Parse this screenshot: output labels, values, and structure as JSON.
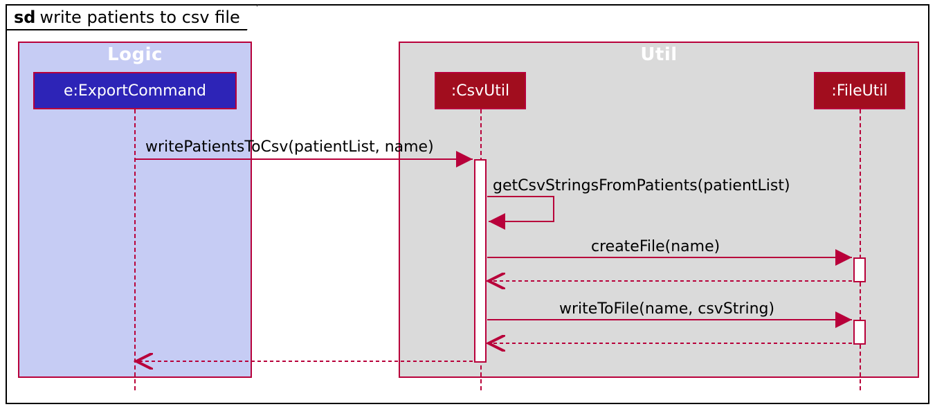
{
  "frame": {
    "tag_prefix": "sd",
    "title": "write patients to csv file"
  },
  "packages": {
    "logic": {
      "name": "Logic"
    },
    "util": {
      "name": "Util"
    }
  },
  "lifelines": {
    "export": {
      "label": "e:ExportCommand"
    },
    "csv": {
      "label": ":CsvUtil"
    },
    "file": {
      "label": ":FileUtil"
    }
  },
  "messages": {
    "m1": "writePatientsToCsv(patientList, name)",
    "m2": "getCsvStringsFromPatients(patientList)",
    "m3": "createFile(name)",
    "m4": "writeToFile(name, csvString)"
  },
  "colors": {
    "uml_red": "#b8003a",
    "logic_bg": "#c6ccf4",
    "util_bg": "#dadada",
    "export_head": "#2d24b7",
    "util_head": "#a10d1e"
  }
}
